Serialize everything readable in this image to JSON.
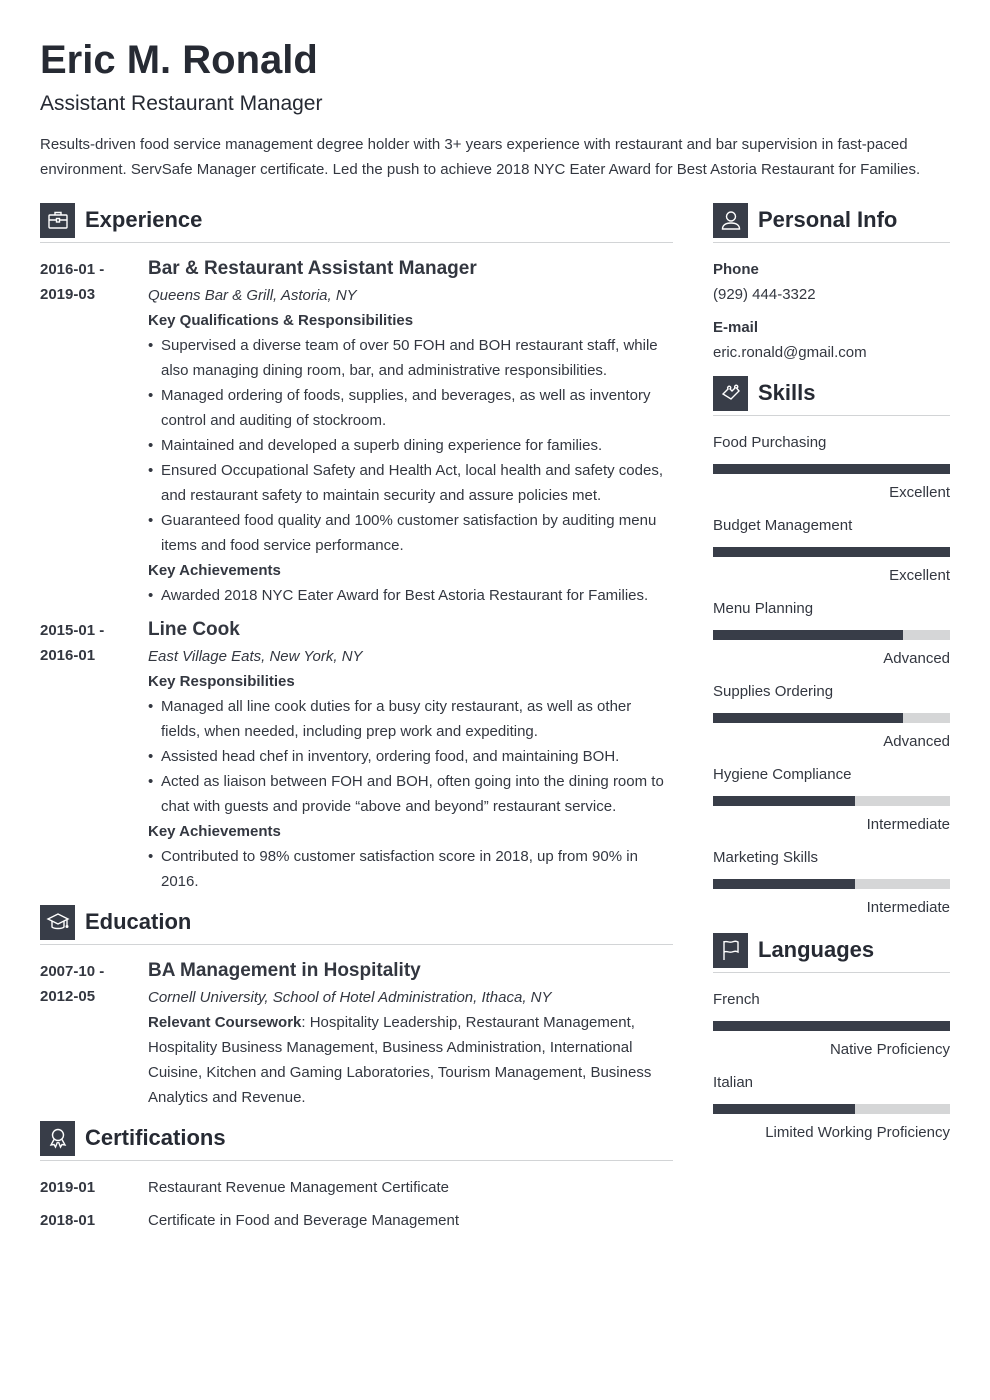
{
  "header": {
    "name": "Eric M. Ronald",
    "title": "Assistant Restaurant Manager",
    "summary": "Results-driven food service management degree holder with 3+ years experience with restaurant and bar supervision in fast-paced environment. ServSafe Manager certificate. Led the push to achieve 2018 NYC Eater Award for Best Astoria Restaurant for Families."
  },
  "colors": {
    "accent": "#383d48",
    "bar_track": "#d5d6d7",
    "text": "#333740",
    "heading": "#262a33"
  },
  "experience": {
    "title": "Experience",
    "icon": "briefcase-icon",
    "entries": [
      {
        "date_start": "2016-01 -",
        "date_end": "2019-03",
        "role": "Bar & Restaurant Assistant Manager",
        "org": "Queens Bar & Grill, Astoria, NY",
        "resp_label": "Key Qualifications & Responsibilities",
        "responsibilities": [
          "Supervised a diverse team of over 50 FOH and BOH restaurant staff, while also managing dining room, bar, and administrative responsibilities.",
          "Managed ordering of foods, supplies, and beverages, as well as inventory control and auditing of stockroom.",
          "Maintained and developed a superb dining experience for families.",
          "Ensured Occupational Safety and Health Act, local health and safety codes, and restaurant safety to maintain security and assure policies met.",
          "Guaranteed food quality and 100% customer satisfaction by auditing menu items and food service performance."
        ],
        "ach_label": "Key Achievements",
        "achievements": [
          "Awarded 2018 NYC Eater Award for Best Astoria Restaurant for Families."
        ]
      },
      {
        "date_start": "2015-01 -",
        "date_end": "2016-01",
        "role": "Line Cook",
        "org": "East Village Eats, New York, NY",
        "resp_label": "Key Responsibilities",
        "responsibilities": [
          "Managed all line cook duties for a busy city restaurant, as well as other fields, when needed, including prep work and expediting.",
          "Assisted head chef in inventory, ordering food, and maintaining BOH.",
          "Acted as liaison between FOH and BOH, often going into the dining room to chat with guests and provide “above and beyond” restaurant service."
        ],
        "ach_label": "Key Achievements",
        "achievements": [
          "Contributed to 98% customer satisfaction score in 2018, up from 90% in 2016."
        ]
      }
    ]
  },
  "education": {
    "title": "Education",
    "icon": "graduation-cap-icon",
    "entries": [
      {
        "date_start": "2007-10 -",
        "date_end": "2012-05",
        "degree": "BA Management in Hospitality",
        "org": "Cornell University, School of Hotel Administration, Ithaca, NY",
        "coursework_label": "Relevant Coursework",
        "coursework": ": Hospitality Leadership, Restaurant Management, Hospitality Business Management, Business Administration, International Cuisine, Kitchen and Gaming Laboratories, Tourism Management, Business Analytics and Revenue."
      }
    ]
  },
  "certifications": {
    "title": "Certifications",
    "icon": "award-ribbon-icon",
    "items": [
      {
        "date": "2019-01",
        "name": "Restaurant Revenue Management Certificate"
      },
      {
        "date": "2018-01",
        "name": "Certificate in Food and Beverage Management"
      }
    ]
  },
  "personal_info": {
    "title": "Personal Info",
    "icon": "person-icon",
    "phone_label": "Phone",
    "phone": "(929) 444-3322",
    "email_label": "E-mail",
    "email": "eric.ronald@gmail.com"
  },
  "skills": {
    "title": "Skills",
    "icon": "puzzle-piece-icon",
    "items": [
      {
        "name": "Food Purchasing",
        "level": "Excellent",
        "fraction": 1.0
      },
      {
        "name": "Budget Management",
        "level": "Excellent",
        "fraction": 1.0
      },
      {
        "name": "Menu Planning",
        "level": "Advanced",
        "fraction": 0.8
      },
      {
        "name": "Supplies Ordering",
        "level": "Advanced",
        "fraction": 0.8
      },
      {
        "name": "Hygiene Compliance",
        "level": "Intermediate",
        "fraction": 0.6
      },
      {
        "name": "Marketing Skills",
        "level": "Intermediate",
        "fraction": 0.6
      }
    ]
  },
  "languages": {
    "title": "Languages",
    "icon": "flag-icon",
    "items": [
      {
        "name": "French",
        "level": "Native Proficiency",
        "fraction": 1.0
      },
      {
        "name": "Italian",
        "level": "Limited Working Proficiency",
        "fraction": 0.6
      }
    ]
  }
}
